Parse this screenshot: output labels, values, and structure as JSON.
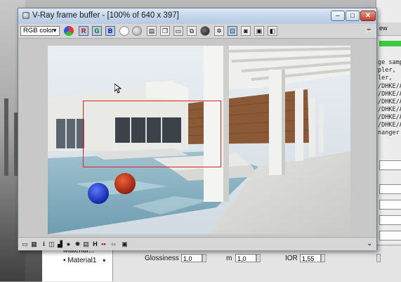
{
  "window": {
    "title": "V-Ray frame buffer - [100% of 640 x 397]",
    "buttons": {
      "minimize": "–",
      "maximize": "□",
      "close": "✕"
    }
  },
  "toolbar": {
    "channel": "RGB color",
    "red_label": "R",
    "green_label": "G",
    "blue_label": "B"
  },
  "statusbar": {
    "info_glyph": "i",
    "history_glyph": "H",
    "expand_glyph": "⌄"
  },
  "background_app": {
    "right_panel_lines": [
      "ge samp",
      "pler,",
      "ler,",
      "/DHKE/A",
      "/DHKE/A",
      "/DHKE/A",
      "/DHKE/A",
      "/DHKE/A",
      "/DHKE/A",
      "nanger"
    ],
    "right_tab": "ew",
    "material_tree": [
      "Material...",
      "Material1"
    ],
    "glossiness_label": "Glossiness",
    "glossiness_value": "1,0",
    "m_label": "m",
    "m_value": "1,0",
    "ior_label": "IOR",
    "ior_value": "1,55",
    "right_spinners": [
      "",
      "",
      "",
      "",
      "",
      ""
    ]
  },
  "colors": {
    "accent_title": "#c4d6ea",
    "region_border": "#e02020",
    "progress_green": "#3ec93e"
  }
}
